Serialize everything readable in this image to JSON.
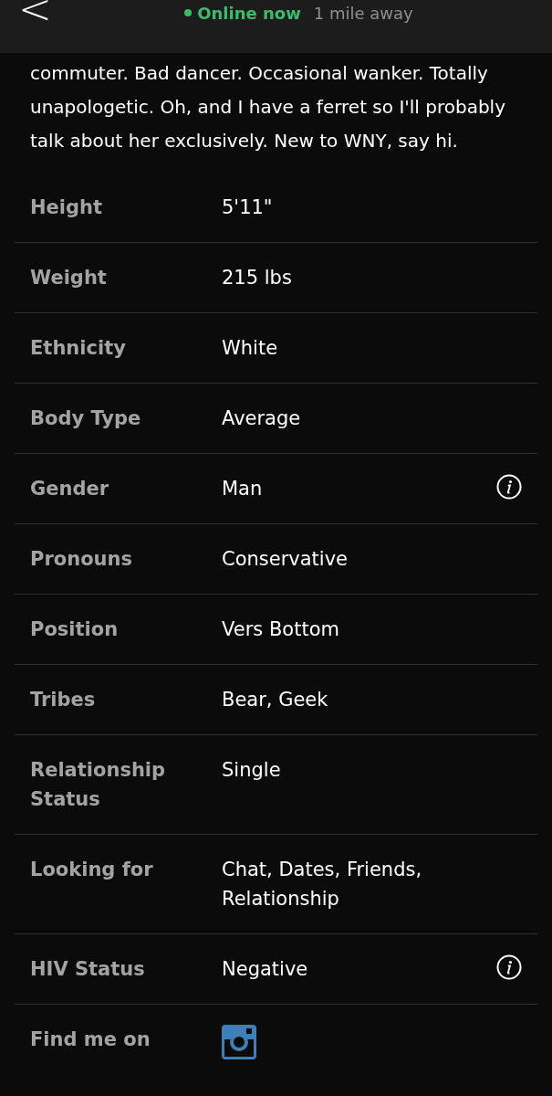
{
  "header": {
    "back": "<",
    "status": "Online now",
    "distance": "1 mile away"
  },
  "bio": "commuter. Bad dancer. Occasional wanker. Totally unapologetic. Oh, and I have a ferret so I'll probably talk about her exclusively. New to WNY, say hi.",
  "details": [
    {
      "kind": "text",
      "label": "Height",
      "value": "5'11\"",
      "info": false
    },
    {
      "kind": "text",
      "label": "Weight",
      "value": "215 lbs",
      "info": false
    },
    {
      "kind": "text",
      "label": "Ethnicity",
      "value": "White",
      "info": false
    },
    {
      "kind": "text",
      "label": "Body Type",
      "value": "Average",
      "info": false
    },
    {
      "kind": "text",
      "label": "Gender",
      "value": "Man",
      "info": true
    },
    {
      "kind": "text",
      "label": "Pronouns",
      "value": "Conservative",
      "info": false
    },
    {
      "kind": "text",
      "label": "Position",
      "value": "Vers Bottom",
      "info": false
    },
    {
      "kind": "text",
      "label": "Tribes",
      "value": "Bear, Geek",
      "info": false
    },
    {
      "kind": "text",
      "label": "Relationship Status",
      "value": "Single",
      "info": false
    },
    {
      "kind": "text",
      "label": "Looking for",
      "value": "Chat, Dates, Friends, Relationship",
      "info": false
    },
    {
      "kind": "text",
      "label": "HIV Status",
      "value": "Negative",
      "info": true
    },
    {
      "kind": "social",
      "label": "Find me on",
      "info": false
    }
  ]
}
